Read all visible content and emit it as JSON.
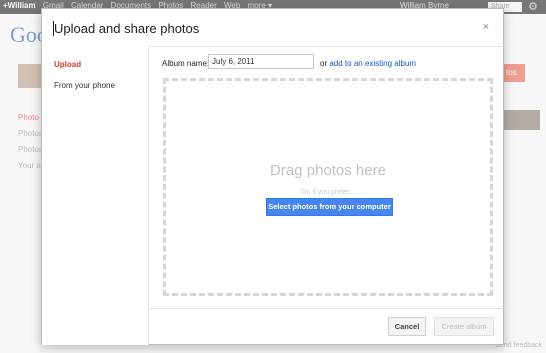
{
  "gbar": {
    "links": [
      "+William",
      "Gmail",
      "Calendar",
      "Documents",
      "Photos",
      "Reader",
      "Web",
      "more ▾"
    ],
    "user": "William Byrne",
    "share": "Share",
    "gear_icon": "gear-icon"
  },
  "background": {
    "logo": "Goo",
    "nav": [
      "Photo",
      "Photos",
      "Photos",
      "Your a"
    ],
    "red_button": "tos",
    "feedback": "Send feedback"
  },
  "dialog": {
    "title": "Upload and share photos",
    "close": "×",
    "sidebar": [
      "Upload",
      "From your phone"
    ],
    "album_label": "Album name:",
    "album_value": "July 6, 2011",
    "or_text": "or",
    "add_existing": "add to an existing album",
    "drop_text": "Drag photos here",
    "or_prefer": "Or, if you prefer...",
    "select_button": "Select photos from your computer",
    "cancel": "Cancel",
    "create": "Create album"
  },
  "colors": {
    "accent_red": "#d23f31",
    "link_blue": "#1155cc",
    "button_blue": "#4787ed"
  }
}
